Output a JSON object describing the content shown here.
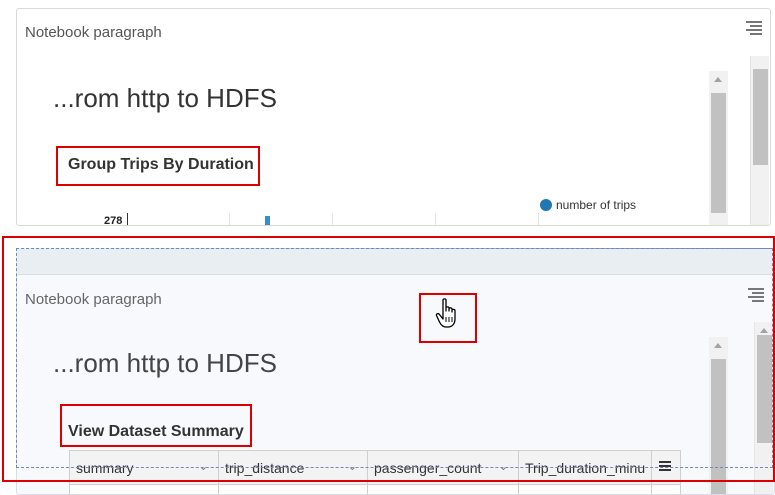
{
  "panel1": {
    "title": "Notebook paragraph",
    "heading": "...rom http to HDFS",
    "section_title": "Group Trips By Duration",
    "chart": {
      "y_max_label": "278",
      "legend_label": "number of trips",
      "series_color": "#1f77b4"
    }
  },
  "panel2": {
    "title": "Notebook paragraph",
    "heading": "...rom http to HDFS",
    "section_title": "View Dataset Summary",
    "table": {
      "columns": [
        "summary",
        "trip_distance",
        "passenger_count",
        "Trip_duration_minu"
      ]
    }
  },
  "colors": {
    "highlight": "#dd0000",
    "accent": "#1f77b4"
  },
  "icons": [
    "menu-lines-icon",
    "hand-pointer-icon",
    "chevron-down-icon",
    "column-menu-icon",
    "scroll-up-arrow-icon"
  ]
}
